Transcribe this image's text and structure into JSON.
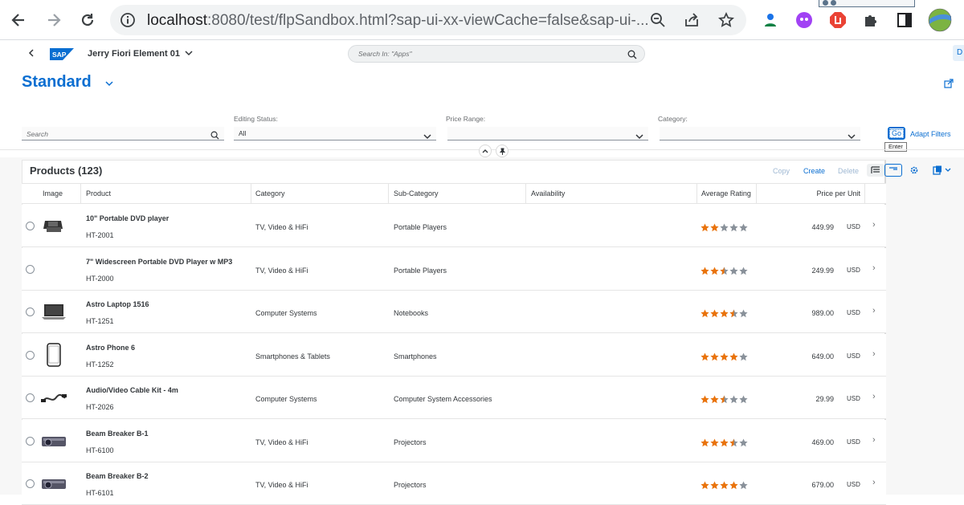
{
  "browser": {
    "url_host": "localhost",
    "url_path": ":8080/test/flpSandbox.html?sap-ui-xx-viewCache=false&sap-ui-..."
  },
  "shell": {
    "app_title": "Jerry Fiori Element 01",
    "search_placeholder": "Search In: \"Apps\"",
    "avatar_initial": "D",
    "logo_text": "SAP"
  },
  "variant": {
    "title": "Standard"
  },
  "filters": {
    "search_placeholder": "Search",
    "editing_status_label": "Editing Status:",
    "editing_status_value": "All",
    "price_range_label": "Price Range:",
    "price_range_value": "",
    "category_label": "Category:",
    "category_value": "",
    "go_label": "Go",
    "go_tooltip": "Enter",
    "adapt_label": "Adapt Filters"
  },
  "table": {
    "title": "Products (123)",
    "toolbar": {
      "copy": "Copy",
      "create": "Create",
      "delete": "Delete"
    },
    "columns": {
      "image": "Image",
      "product": "Product",
      "category": "Category",
      "subcategory": "Sub-Category",
      "availability": "Availability",
      "rating": "Average Rating",
      "price": "Price per Unit"
    },
    "rows": [
      {
        "name": "10\" Portable DVD player",
        "id": "HT-2001",
        "category": "TV, Video & HiFi",
        "subcategory": "Portable Players",
        "rating": 2,
        "price": "449.99",
        "currency": "USD",
        "image": "dvd-player"
      },
      {
        "name": "7\" Widescreen Portable DVD Player w MP3",
        "id": "HT-2000",
        "category": "TV, Video & HiFi",
        "subcategory": "Portable Players",
        "rating": 2.5,
        "price": "249.99",
        "currency": "USD",
        "image": ""
      },
      {
        "name": "Astro Laptop 1516",
        "id": "HT-1251",
        "category": "Computer Systems",
        "subcategory": "Notebooks",
        "rating": 3.5,
        "price": "989.00",
        "currency": "USD",
        "image": "laptop"
      },
      {
        "name": "Astro Phone 6",
        "id": "HT-1252",
        "category": "Smartphones & Tablets",
        "subcategory": "Smartphones",
        "rating": 4,
        "price": "649.00",
        "currency": "USD",
        "image": "phone"
      },
      {
        "name": "Audio/Video Cable Kit - 4m",
        "id": "HT-2026",
        "category": "Computer Systems",
        "subcategory": "Computer System Accessories",
        "rating": 2.5,
        "price": "29.99",
        "currency": "USD",
        "image": "cable"
      },
      {
        "name": "Beam Breaker B-1",
        "id": "HT-6100",
        "category": "TV, Video & HiFi",
        "subcategory": "Projectors",
        "rating": 3.5,
        "price": "469.00",
        "currency": "USD",
        "image": "projector"
      },
      {
        "name": "Beam Breaker B-2",
        "id": "HT-6101",
        "category": "TV, Video & HiFi",
        "subcategory": "Projectors",
        "rating": 4,
        "price": "679.00",
        "currency": "USD",
        "image": "projector"
      }
    ]
  },
  "colors": {
    "accent": "#0a6ed1",
    "star_filled": "#e9730c",
    "star_empty": "#89919a"
  }
}
